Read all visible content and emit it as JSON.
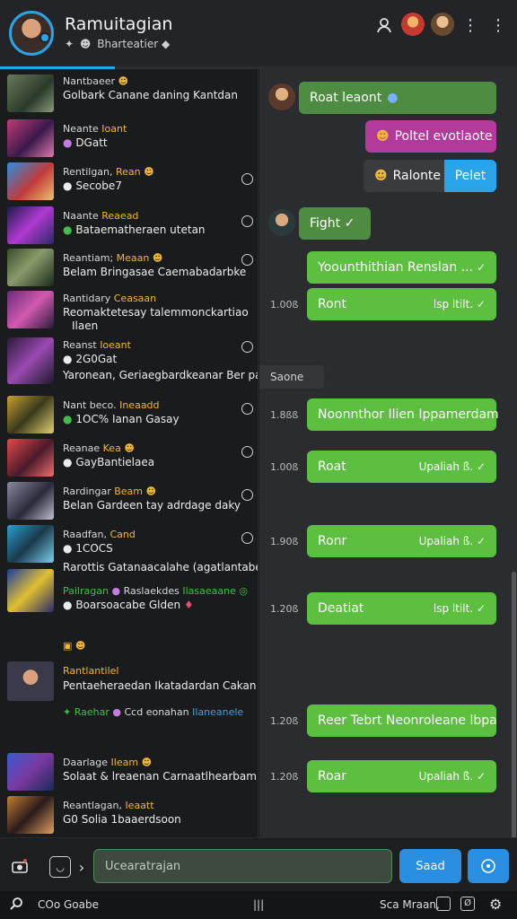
{
  "header": {
    "title": "Ramuitagian",
    "subtitle": "Bharteatier",
    "subtitle_icons": [
      "sparkle-icon",
      "face-icon",
      "gem-icon"
    ],
    "accent": "#2aa4e8"
  },
  "list": {
    "items": [
      {
        "line1": "Nantbaeer",
        "line2": "Golbark Canane daning Kantdan",
        "line3": ""
      },
      {
        "line1": "Neante",
        "line1_hl": "Ioant",
        "line2": "DGatt",
        "line3": ""
      },
      {
        "line1": "Rentilgan,",
        "line1_hl": "Rean",
        "line2": "Secobe7",
        "line3": ""
      },
      {
        "line1": "Naante",
        "line1_hl": "Reaead",
        "line2": "Bataematheraen utetan",
        "line3": ""
      },
      {
        "line1": "Reantiam;",
        "line1_hl": "Meaan",
        "line2": "Belam Bringasae Caemabadarbke",
        "line3": ""
      },
      {
        "line1": "Rantidary",
        "line1_hl": "Ceasaan",
        "line2": "Reomaktetesay talemmonckartiao",
        "line3": "Ilaen"
      },
      {
        "line1": "Reanst",
        "line1_hl": "Ioeant",
        "line2": "2G0Gat",
        "line3": "Yaronean, Geriaegbardkeanar Ber padles"
      },
      {
        "line1": "Nant beco.",
        "line1_hl": "Ineaadd",
        "line2": "1OC% Ianan Gasay",
        "line3": ""
      },
      {
        "line1": "Reanae",
        "line1_hl": "Kea",
        "line2": "GayBantielaea",
        "line3": ""
      },
      {
        "line1": "Rardingar",
        "line1_hl": "Beam",
        "line2": "Belan Gardeen tay adrdage daky",
        "line3": ""
      },
      {
        "line1": "Raadfan,",
        "line1_hl": "Cand",
        "line2": "1COCS",
        "line3": "Rarottis Gatanaacalahe (agatlantabe)"
      },
      {
        "line1": "Pailragan",
        "line1_hl": "",
        "line2": "Boarsoacabe Glden",
        "line3": "",
        "tag_a": "Raslaekdes",
        "tag_b": "Ilasaeaane"
      },
      {
        "line1": "Rantlantilel",
        "line1_hl": "",
        "line2": "Pentaeheraedan Ikatadardan Cakan",
        "line3": "",
        "tag_a": "Raehar",
        "tag_b": "Ccd eonahan",
        "tag_c": "Ilaneanele"
      },
      {
        "line1": "Daarlage",
        "line1_hl": "Ileam",
        "line2": "Solaat & lreaenan Carnaatlhearbam",
        "line3": ""
      },
      {
        "line1": "Reantlagan,",
        "line1_hl": "Ieaatt",
        "line2": "G0 Solia 1baaerdsoon",
        "line3": ""
      }
    ]
  },
  "chat": {
    "messages": [
      {
        "text": "Roat leaont",
        "time": ""
      },
      {
        "text": "Poltel evotlaote",
        "time": ""
      },
      {
        "text": "Ralonte",
        "aside": "Pelet",
        "time": ""
      },
      {
        "text": "Fight ✓",
        "time": ""
      },
      {
        "text": "Yoounthithian Renslan ...",
        "time": ""
      },
      {
        "text": "Ront",
        "aside": "lsp ltilt. ✓",
        "time": "1.00ß"
      },
      {
        "text": "Saone",
        "time": ""
      },
      {
        "text": "Noonnthor Ilien Ippamerdam",
        "time": "1.8ßß"
      },
      {
        "text": "Roat",
        "aside": "Upaliah ß. ✓",
        "time": "1.00ß"
      },
      {
        "text": "Ronr",
        "aside": "Upaliah ß. ✓",
        "time": "1.90ß"
      },
      {
        "text": "Deatiat",
        "aside": "lsp ltilt. ✓",
        "time": "1.20ß"
      },
      {
        "text": "Reer Tebrt Neonroleane lbpa",
        "time": "1.20ß"
      },
      {
        "text": "Roar",
        "aside": "Upaliah ß. ✓",
        "time": "1.20ß"
      }
    ]
  },
  "composer": {
    "placeholder": "Ucearatrajan",
    "send_label": "Saad",
    "input_border_color": "#4a8d52",
    "send_color": "#2a8fe0"
  },
  "statusbar": {
    "left": "COo Goabe",
    "right": "Sca Mraan,"
  }
}
